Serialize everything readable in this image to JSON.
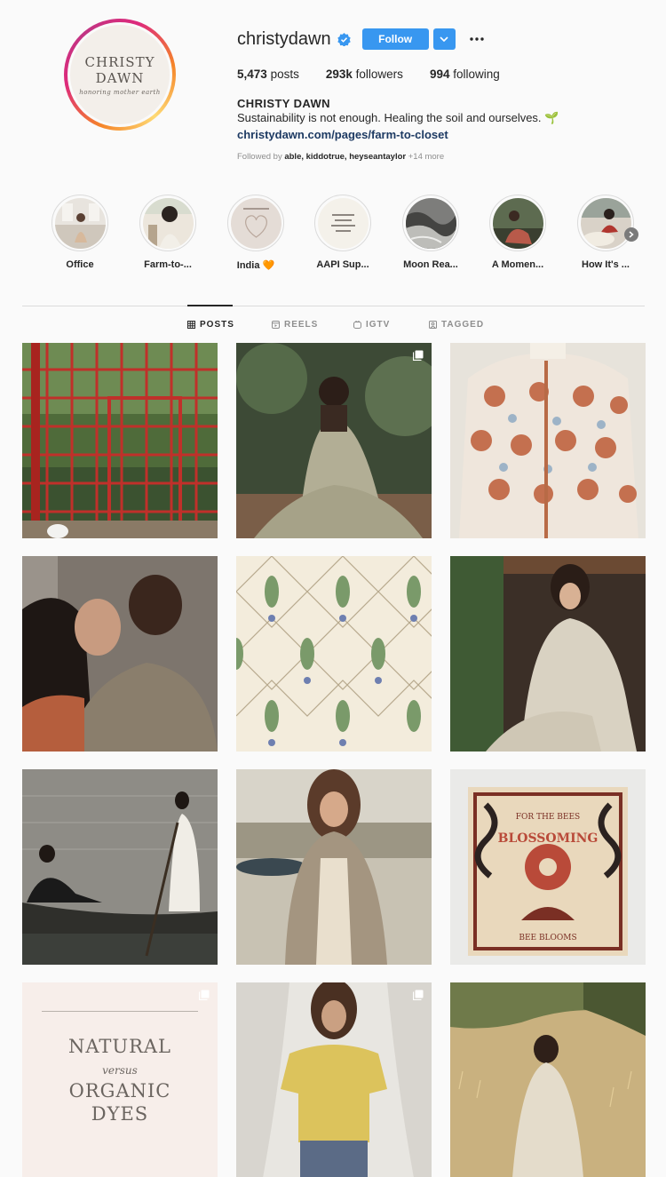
{
  "profile": {
    "avatar_logo": "CHRISTY DAWN",
    "avatar_tagline": "honoring mother earth",
    "username": "christydawn",
    "follow_label": "Follow",
    "posts_count": "5,473",
    "posts_label": "posts",
    "followers_count": "293k",
    "followers_label": "followers",
    "following_count": "994",
    "following_label": "following",
    "full_name": "CHRISTY DAWN",
    "bio": "Sustainability is not enough. Healing the soil and ourselves. 🌱",
    "link": "christydawn.com/pages/farm-to-closet",
    "followed_by_prefix": "Followed by",
    "followed_by_names": "able, kiddotrue, heyseantaylor",
    "followed_by_more": "+14 more"
  },
  "highlights": [
    {
      "label": "Office"
    },
    {
      "label": "Farm-to-..."
    },
    {
      "label": "India 🧡"
    },
    {
      "label": "AAPI Sup..."
    },
    {
      "label": "Moon Rea..."
    },
    {
      "label": "A Momen..."
    },
    {
      "label": "How It's ..."
    }
  ],
  "tabs": [
    {
      "label": "POSTS",
      "icon": "grid-icon"
    },
    {
      "label": "REELS",
      "icon": "reels-icon"
    },
    {
      "label": "IGTV",
      "icon": "igtv-icon"
    },
    {
      "label": "TAGGED",
      "icon": "tagged-icon"
    }
  ],
  "posts": {
    "text_post": {
      "line1": "NATURAL",
      "line2": "versus",
      "line3": "ORGANIC",
      "line4": "DYES"
    },
    "bandana_top": "FOR THE BEES",
    "bandana_word": "BLOSSOMING",
    "bandana_bottom": "BEE BLOOMS"
  },
  "colors": {
    "follow_blue": "#3897f0",
    "verified_blue": "#3897f0",
    "link_navy": "#1d3a63",
    "muted_gray": "#8e8e8e"
  }
}
